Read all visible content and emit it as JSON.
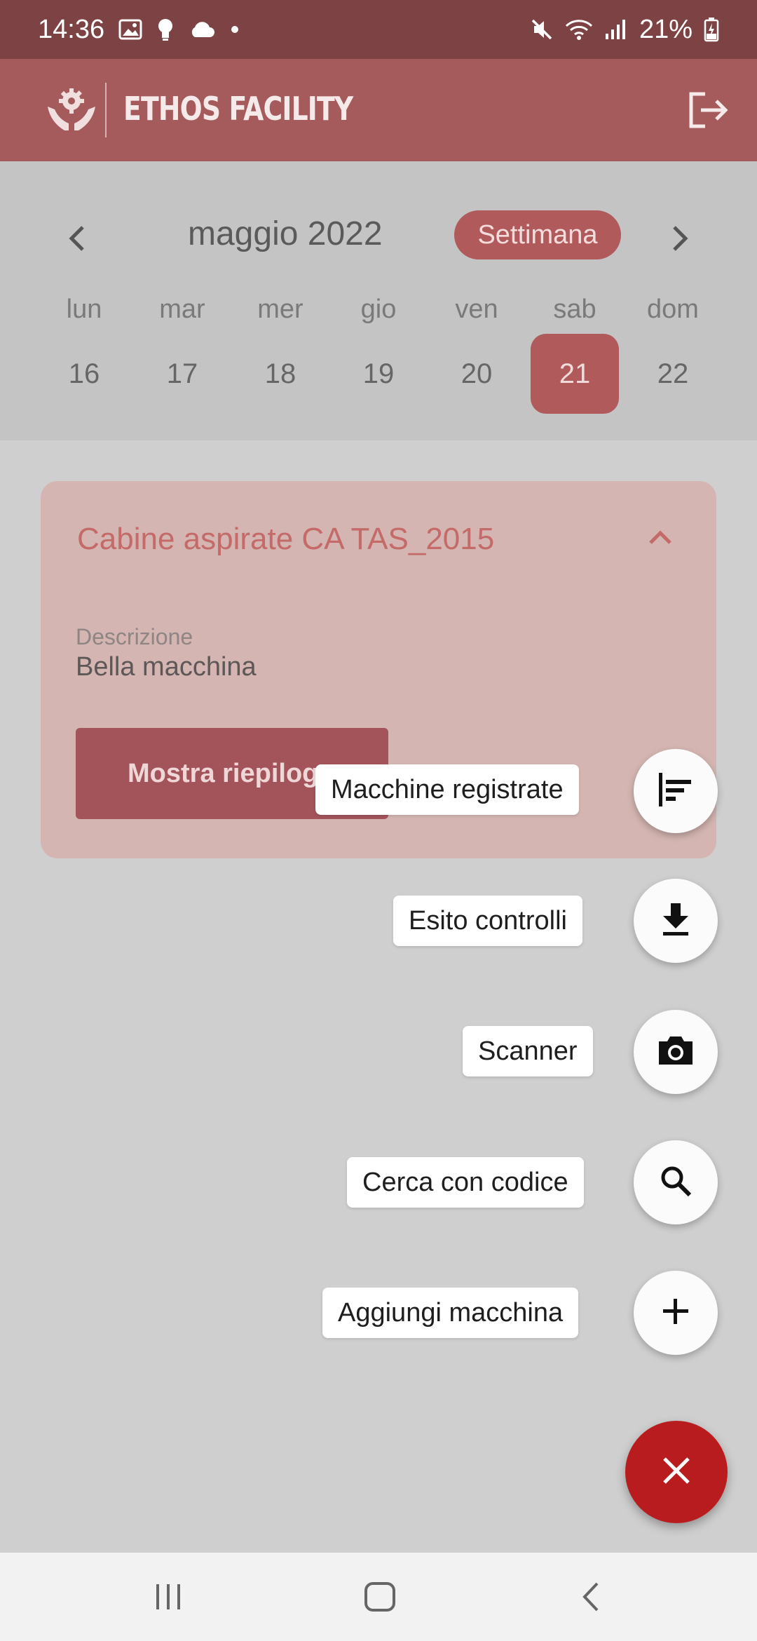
{
  "status_bar": {
    "time": "14:36",
    "battery": "21%",
    "icons": [
      "image-icon",
      "bulb-icon",
      "cloud-icon",
      "dot-icon",
      "mute-icon",
      "wifi-icon",
      "signal-icon",
      "battery-charging-icon"
    ]
  },
  "app_bar": {
    "title": "ETHOS FACILITY",
    "logo_icon": "hands-gear-logo",
    "logout_icon": "logout-icon"
  },
  "calendar": {
    "month": "maggio 2022",
    "view_toggle": "Settimana",
    "days": [
      {
        "name": "lun",
        "num": "16"
      },
      {
        "name": "mar",
        "num": "17"
      },
      {
        "name": "mer",
        "num": "18"
      },
      {
        "name": "gio",
        "num": "19"
      },
      {
        "name": "ven",
        "num": "20"
      },
      {
        "name": "sab",
        "num": "21"
      },
      {
        "name": "dom",
        "num": "22"
      }
    ],
    "selected_day": "21"
  },
  "card": {
    "title": "Cabine aspirate CA TAS_2015",
    "desc_label": "Descrizione",
    "desc_value": "Bella macchina",
    "button_label": "Mostra riepilogo"
  },
  "speed_dial": {
    "items": [
      {
        "label": "Macchine registrate",
        "icon": "sort-list-icon"
      },
      {
        "label": "Esito controlli",
        "icon": "download-icon"
      },
      {
        "label": "Scanner",
        "icon": "camera-icon"
      },
      {
        "label": "Cerca con codice",
        "icon": "search-icon"
      },
      {
        "label": "Aggiungi macchina",
        "icon": "plus-icon"
      }
    ],
    "close_icon": "close-icon"
  },
  "colors": {
    "status_bar": "#7c4244",
    "app_bar": "#a55a5c",
    "accent": "#b05a5c",
    "main_fab": "#b91c1f"
  }
}
